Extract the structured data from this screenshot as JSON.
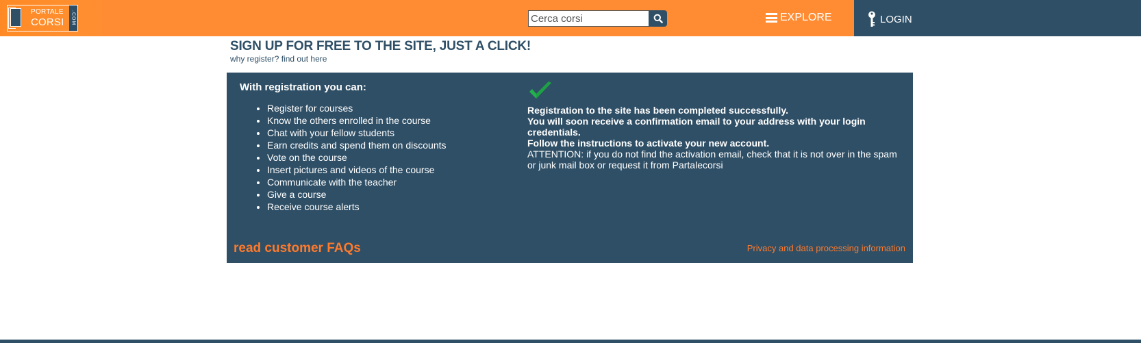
{
  "header": {
    "logo": {
      "line1": "PORTALE",
      "line2": "CORSI",
      "suffix": ".COM"
    },
    "search_placeholder": "Cerca corsi",
    "search_icon": "search-icon",
    "explore_label": "EXPLORE",
    "explore_icon": "menu-icon",
    "login_label": "LOGIN",
    "login_icon": "key-icon"
  },
  "page": {
    "title": "SIGN UP FOR FREE TO THE SITE, JUST A CLICK!",
    "subtitle": "why register? find out here"
  },
  "panel": {
    "heading": "With registration you can:",
    "benefits": [
      "Register for courses",
      "Know the others enrolled in the course",
      "Chat with your fellow students",
      "Earn credits and spend them on discounts",
      "Vote on the course",
      "Insert pictures and videos of the course",
      "Communicate with the teacher",
      "Give a course",
      "Receive course alerts"
    ],
    "success_icon": "checkmark-icon",
    "success_line1": "Registration to the site has been completed successfully.",
    "success_line2": "You will soon receive a confirmation email to your address with your login credentials.",
    "success_line3": "Follow the instructions to activate your new account.",
    "attention": "ATTENTION: if you do not find the activation email, check that it is not over in the spam or junk mail box or request it from Partalecorsi",
    "faq_link": "read customer FAQs",
    "privacy_link": "Privacy and data processing information"
  },
  "colors": {
    "orange": "#ff8c32",
    "navy": "#2f4f66",
    "link_orange": "#ff7a2b",
    "check_green": "#22b14c"
  }
}
